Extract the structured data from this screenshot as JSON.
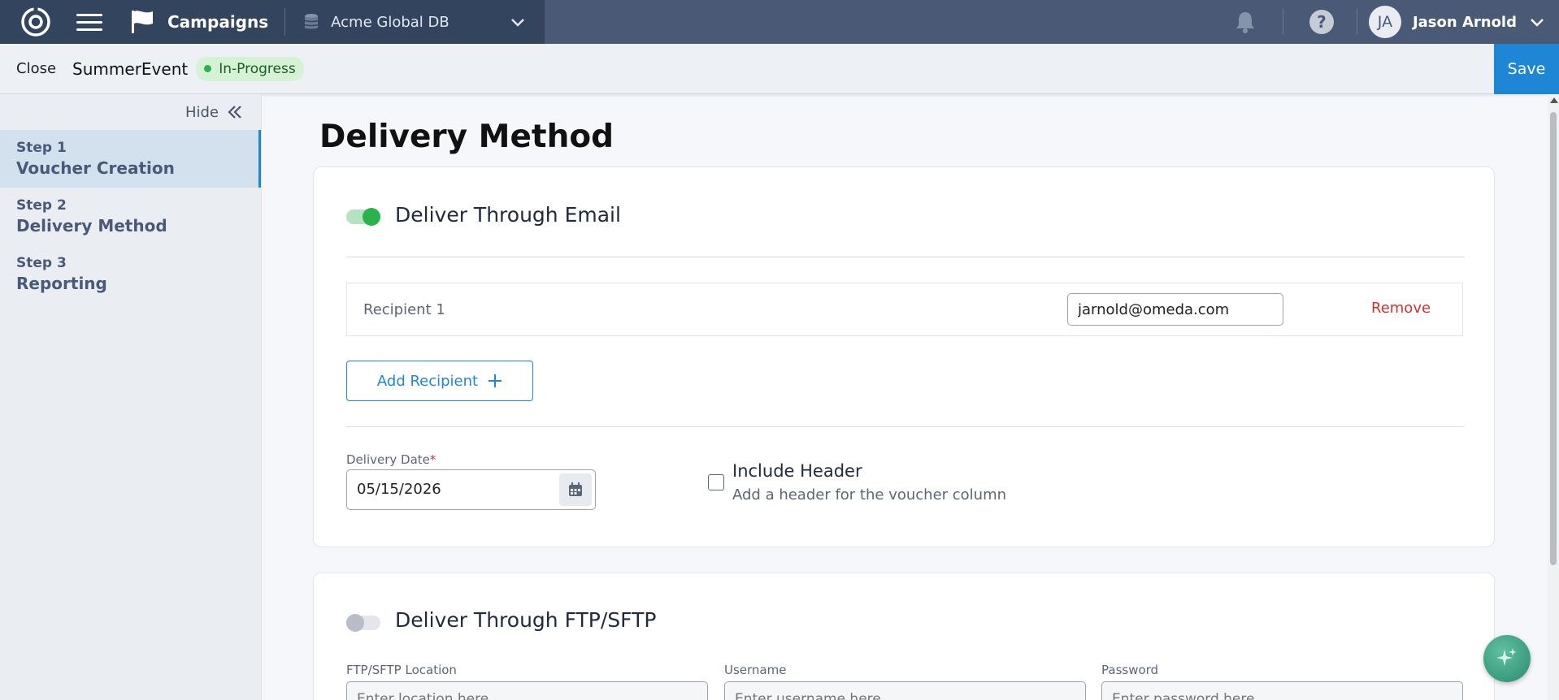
{
  "topbar": {
    "app_name": "Campaigns",
    "db_name": "Acme Global DB",
    "help_label": "?",
    "user_initials": "JA",
    "user_name": "Jason Arnold"
  },
  "subbar": {
    "close_label": "Close",
    "campaign_name": "SummerEvent",
    "status": "In-Progress",
    "save_label": "Save"
  },
  "sidebar": {
    "hide_label": "Hide",
    "steps": [
      {
        "num": "Step 1",
        "label": "Voucher Creation",
        "active": true
      },
      {
        "num": "Step 2",
        "label": "Delivery Method",
        "active": false
      },
      {
        "num": "Step 3",
        "label": "Reporting",
        "active": false
      }
    ]
  },
  "main": {
    "title": "Delivery Method",
    "email_section": {
      "title": "Deliver Through Email",
      "toggle_on": true,
      "recipients": [
        {
          "label": "Recipient 1",
          "email": "jarnold@omeda.com",
          "remove_label": "Remove"
        }
      ],
      "add_recipient_label": "Add Recipient",
      "delivery_date_label": "Delivery Date",
      "delivery_date_required": "*",
      "delivery_date_value": "05/15/2026",
      "include_header_label": "Include Header",
      "include_header_desc": "Add a header for the voucher column",
      "include_header_checked": false
    },
    "ftp_section": {
      "title": "Deliver Through FTP/SFTP",
      "toggle_on": false,
      "location_label": "FTP/SFTP Location",
      "location_placeholder": "Enter location here",
      "username_label": "Username",
      "username_placeholder": "Enter username here",
      "password_label": "Password",
      "password_placeholder": "Enter password here"
    }
  },
  "colors": {
    "accent": "#1f86d6",
    "nav_dark": "#33445f",
    "nav": "#4a5a76",
    "success": "#2bb24c",
    "danger": "#d32f2f"
  }
}
